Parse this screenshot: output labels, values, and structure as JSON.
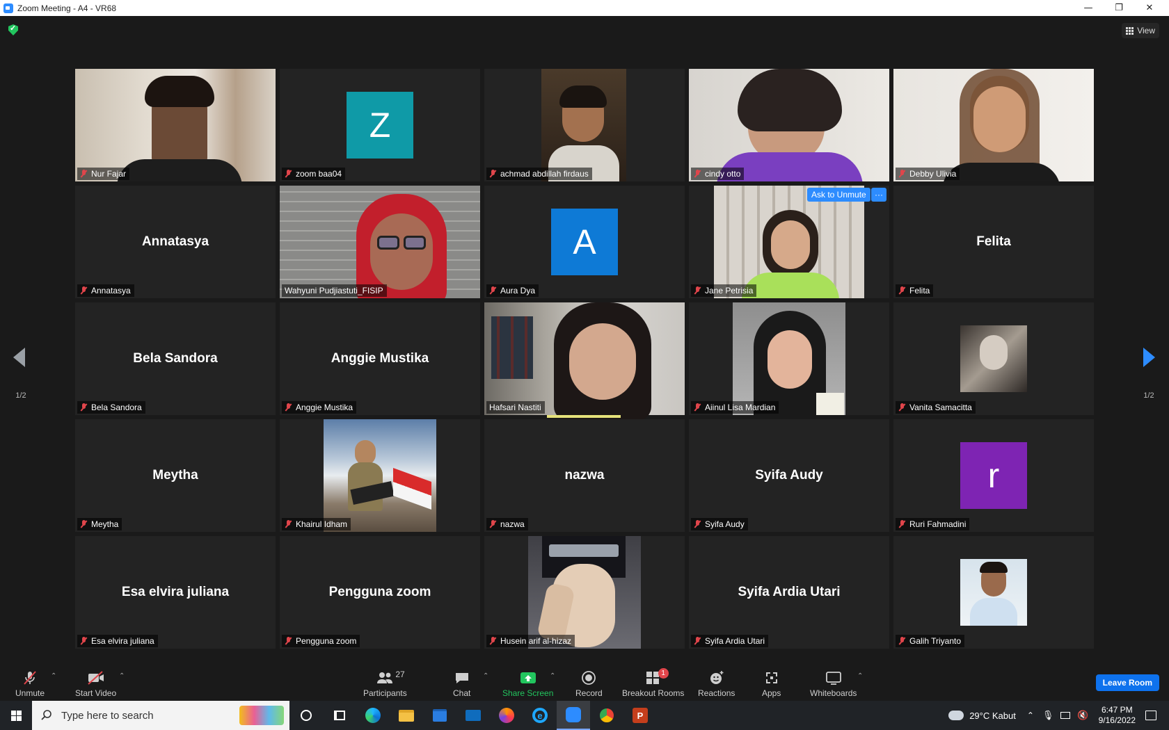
{
  "window": {
    "title": "Zoom Meeting - A4 - VR68",
    "minimize": "—",
    "restore": "❐",
    "close": "✕"
  },
  "header": {
    "view_label": "View"
  },
  "pagination": {
    "prev_page": "1/2",
    "next_page": "1/2"
  },
  "tiles": [
    {
      "name": "Nur Fajar",
      "type": "video",
      "muted": true
    },
    {
      "name": "zoom baa04",
      "type": "avatar",
      "letter": "Z",
      "color": "#0f9aa7",
      "muted": true
    },
    {
      "name": "achmad abdillah firdaus",
      "type": "video",
      "muted": true
    },
    {
      "name": "cindy otto",
      "type": "video",
      "muted": true
    },
    {
      "name": "Debby Ulivia",
      "type": "video",
      "muted": true
    },
    {
      "name": "Annatasya",
      "type": "name",
      "muted": true
    },
    {
      "name": "Wahyuni Pudjiastuti_FISIP",
      "type": "video",
      "muted": false,
      "active": true
    },
    {
      "name": "Aura Dya",
      "type": "avatar",
      "letter": "A",
      "color": "#0e7ad6",
      "muted": true
    },
    {
      "name": "Jane Petrisia",
      "type": "video",
      "muted": true,
      "ask_to_unmute": "Ask to Unmute",
      "more": "···"
    },
    {
      "name": "Felita",
      "type": "name",
      "muted": true
    },
    {
      "name": "Bela Sandora",
      "type": "name",
      "muted": true
    },
    {
      "name": "Anggie Mustika",
      "type": "name",
      "muted": true
    },
    {
      "name": "Hafsari Nastiti",
      "type": "video",
      "muted": false,
      "speaking": true
    },
    {
      "name": "Aiinul Lisa Mardian",
      "type": "video",
      "muted": true
    },
    {
      "name": "Vanita Samacitta",
      "type": "photo",
      "muted": true
    },
    {
      "name": "Meytha",
      "type": "name",
      "muted": true
    },
    {
      "name": "Khairul Idham",
      "type": "video",
      "muted": true
    },
    {
      "name": "nazwa",
      "type": "name",
      "muted": true
    },
    {
      "name": "Syifa Audy",
      "type": "name",
      "muted": true
    },
    {
      "name": "Ruri Fahmadini",
      "type": "avatar",
      "letter": "r",
      "color": "#7e24b3",
      "muted": true
    },
    {
      "name": "Esa elvira juliana",
      "type": "name",
      "muted": true
    },
    {
      "name": "Pengguna zoom",
      "type": "name",
      "muted": true
    },
    {
      "name": "Husein arif al-hizaz",
      "type": "video",
      "muted": true
    },
    {
      "name": "Syifa Ardia Utari",
      "type": "name",
      "muted": true
    },
    {
      "name": "Galih Triyanto",
      "type": "photo",
      "muted": true
    }
  ],
  "toolbar": {
    "unmute": "Unmute",
    "start_video": "Start Video",
    "participants": "Participants",
    "participants_count": "27",
    "chat": "Chat",
    "share_screen": "Share Screen",
    "record": "Record",
    "breakout_rooms": "Breakout Rooms",
    "breakout_badge": "1",
    "reactions": "Reactions",
    "apps": "Apps",
    "whiteboards": "Whiteboards",
    "leave_room": "Leave Room"
  },
  "taskbar": {
    "search_placeholder": "Type here to search",
    "weather": "29°C  Kabut",
    "time": "6:47 PM",
    "date": "9/16/2022"
  },
  "colors": {
    "accent": "#2d8cff",
    "muted_mic": "#e0454b",
    "share_green": "#22c55e",
    "active_speaker": "#e6e27a",
    "leave": "#0e72ed"
  }
}
